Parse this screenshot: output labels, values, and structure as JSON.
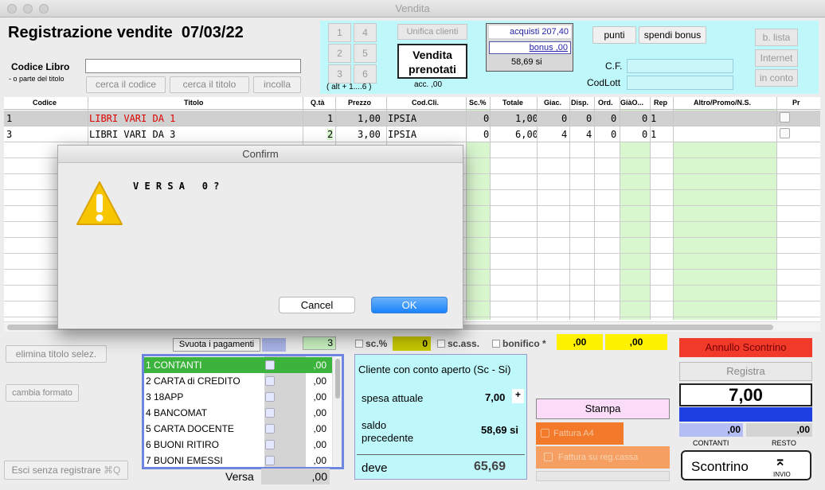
{
  "window": {
    "title": "Vendita"
  },
  "header": {
    "title": "Registrazione vendite",
    "date": "07/03/22",
    "codice_label": "Codice Libro",
    "codice_hint": "- o parte del  titolo",
    "btn_cerca_codice": "cerca il codice",
    "btn_cerca_titolo": "cerca il titolo",
    "btn_incolla": "incolla"
  },
  "keypad": {
    "keys": [
      "1",
      "4",
      "2",
      "5",
      "3",
      "6"
    ],
    "hint": "( alt + 1....6 )"
  },
  "customer": {
    "unifica": "Unifica clienti",
    "prenotati1": "Vendita",
    "prenotati2": "prenotati",
    "acc": "acc. ,00",
    "acquisti": "acquisti 207,40",
    "bonus": "bonus ,00",
    "points_si": "58,69  si",
    "punti": "punti",
    "spendi": "spendi bonus",
    "cf": "C.F.",
    "codlott": "CodLott",
    "blista": "b. lista",
    "internet": "Internet",
    "inconto": "in conto"
  },
  "table": {
    "headers": [
      "Codice",
      "Titolo",
      "Q.tà",
      "Prezzo",
      "Cod.Cli.",
      "Sc.%",
      "Totale",
      "Giac.",
      "Disp.",
      "Ord.",
      "GiàO...",
      "Rep",
      "Altro/Promo/N.S.",
      "Pr"
    ],
    "rows": [
      {
        "codice": "1",
        "titolo": "LIBRI VARI DA 1",
        "qta": "1",
        "prezzo": "1,00",
        "codcli": "IPSIA",
        "sc": "0",
        "totale": "1,00",
        "giac": "0",
        "disp": "0",
        "ord": "0",
        "giao": "0",
        "rep": "1"
      },
      {
        "codice": "3",
        "titolo": "LIBRI VARI DA 3",
        "qta": "2",
        "prezzo": "3,00",
        "codcli": "IPSIA",
        "sc": "0",
        "totale": "6,00",
        "giac": "4",
        "disp": "4",
        "ord": "0",
        "giao": "0",
        "rep": "1"
      }
    ]
  },
  "dialog": {
    "title": "Confirm",
    "message": "V E R S A   0 ?",
    "cancel": "Cancel",
    "ok": "OK"
  },
  "bottom": {
    "elimina": "elimina titolo selez.",
    "cambia": "cambia formato",
    "esci": "Esci senza registrare",
    "svuota": "Svuota i pagamenti",
    "count": "3",
    "sc_label": "sc.%",
    "sc_val": "0",
    "scass": "sc.ass.",
    "bonifico": "bonifico *",
    "y1": ",00",
    "y2": ",00",
    "versa_label": "Versa",
    "versa_val": ",00"
  },
  "payments": [
    {
      "label": "1 CONTANTI",
      "value": ",00"
    },
    {
      "label": "2 CARTA di CREDITO",
      "value": ",00"
    },
    {
      "label": "3 18APP",
      "value": ",00"
    },
    {
      "label": "4 BANCOMAT",
      "value": ",00"
    },
    {
      "label": "5 CARTA DOCENTE",
      "value": ",00"
    },
    {
      "label": "6 BUONI RITIRO",
      "value": ",00"
    },
    {
      "label": "7 BUONI EMESSI",
      "value": ",00"
    }
  ],
  "conto": {
    "title": "Cliente con conto aperto (Sc - Si)",
    "spesa_label": "spesa attuale",
    "spesa_val": "7,00",
    "plus": "+",
    "saldo_label1": "saldo",
    "saldo_label2": "precedente",
    "saldo_val": "58,69  si",
    "deve_label": "deve",
    "deve_val": "65,69"
  },
  "actions": {
    "stampa": "Stampa",
    "fattura_a4": "Fattura A4",
    "fattura_reg": "Fattura su reg.cassa",
    "annullo": "Annullo Scontrino",
    "registra": "Registra",
    "total": "7,00",
    "contanti_val": ",00",
    "resto_val": ",00",
    "contanti": "CONTANTI",
    "resto": "RESTO",
    "scontrino": "Scontrino",
    "invio": "INVIO"
  }
}
